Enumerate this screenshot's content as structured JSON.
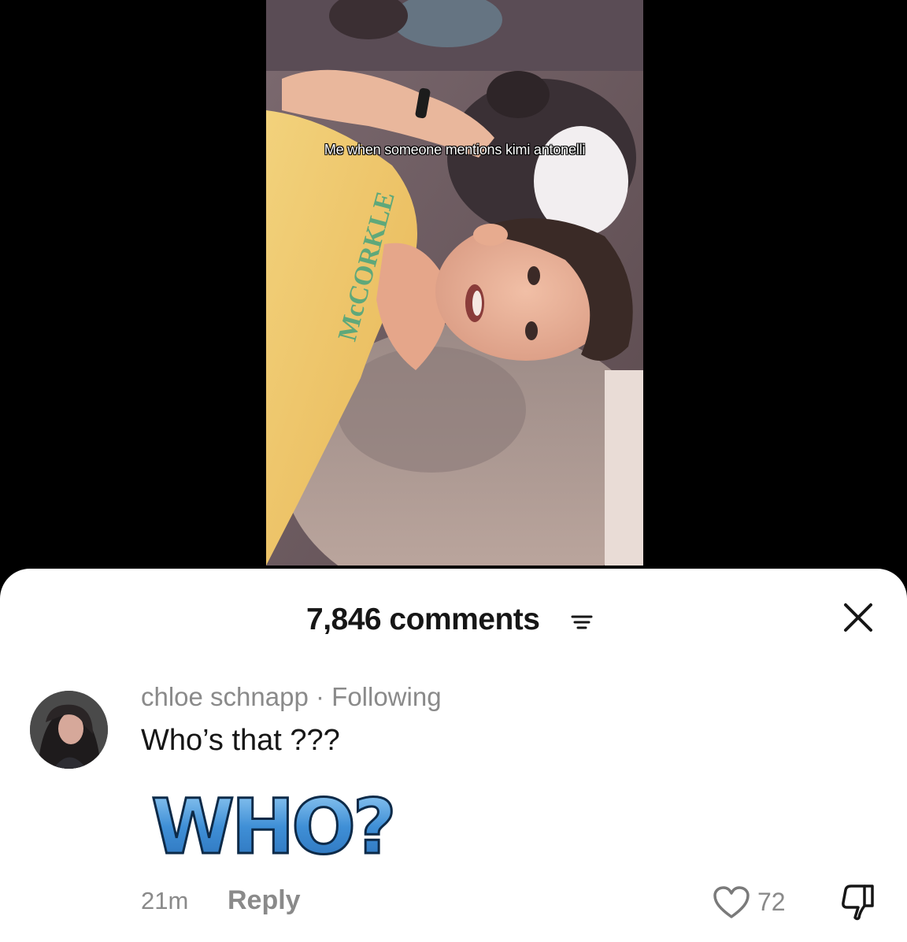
{
  "video": {
    "caption": "Me when someone mentions kimi antonelli",
    "shirt_text": "McCORKLE"
  },
  "comments_sheet": {
    "count_label": "7,846 comments",
    "sort_icon": "filter-lines-icon",
    "close_icon": "close-icon"
  },
  "comment": {
    "author": "chloe schnapp",
    "separator": " · ",
    "relation": "Following",
    "text": "Who’s that ???",
    "sticker_text": "WHO?",
    "time": "21m",
    "reply_label": "Reply",
    "like_count": "72",
    "like_icon": "heart-outline-icon",
    "dislike_icon": "thumbs-down-outline-icon"
  },
  "colors": {
    "sheet_bg": "#ffffff",
    "screen_bg": "#000000",
    "text_primary": "#161616",
    "text_secondary": "#8a8a8a",
    "sticker_blue": "#3f8fd6"
  }
}
